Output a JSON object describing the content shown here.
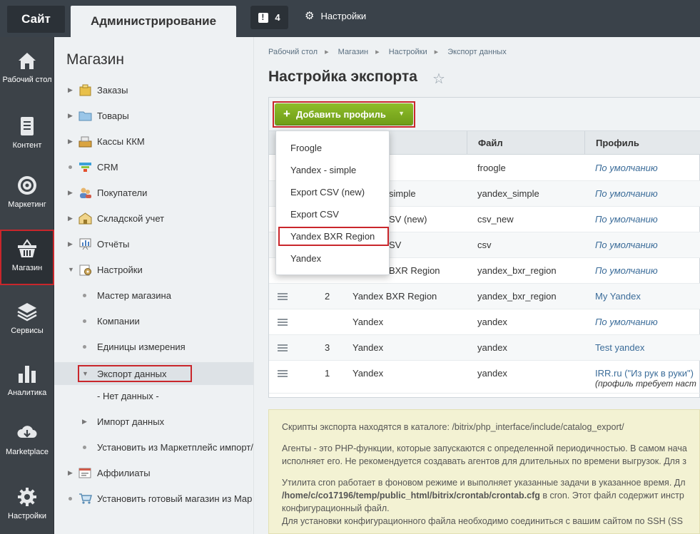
{
  "top": {
    "site_tab": "Сайт",
    "admin_tab": "Администрирование",
    "notif_count": "4",
    "settings": "Настройки"
  },
  "iconbar": [
    {
      "label": "Рабочий стол",
      "icon": "home-icon"
    },
    {
      "label": "Контент",
      "icon": "document-icon"
    },
    {
      "label": "Маркетинг",
      "icon": "target-icon"
    },
    {
      "label": "Магазин",
      "icon": "basket-icon"
    },
    {
      "label": "Сервисы",
      "icon": "layers-icon"
    },
    {
      "label": "Аналитика",
      "icon": "bar-chart-icon"
    },
    {
      "label": "Marketplace",
      "icon": "cloud-download-icon"
    },
    {
      "label": "Настройки",
      "icon": "gear-icon"
    }
  ],
  "menu": {
    "title": "Магазин",
    "items": [
      {
        "label": "Заказы"
      },
      {
        "label": "Товары"
      },
      {
        "label": "Кассы ККМ"
      },
      {
        "label": "CRM"
      },
      {
        "label": "Покупатели"
      },
      {
        "label": "Складской учет"
      },
      {
        "label": "Отчёты"
      },
      {
        "label": "Настройки"
      },
      {
        "label": "Мастер магазина"
      },
      {
        "label": "Компании"
      },
      {
        "label": "Единицы измерения"
      },
      {
        "label": "Экспорт данных"
      },
      {
        "label": "- Нет данных -"
      },
      {
        "label": "Импорт данных"
      },
      {
        "label": "Установить из Маркетплейс импорт/"
      },
      {
        "label": "Аффилиаты"
      },
      {
        "label": "Установить готовый магазин из Мар"
      }
    ]
  },
  "breadcrumbs": [
    "Рабочий стол",
    "Магазин",
    "Настройки",
    "Экспорт данных"
  ],
  "page_title": "Настройка экспорта",
  "toolbar": {
    "add_profile": "Добавить профиль"
  },
  "table": {
    "headers": [
      "ме",
      "Файл",
      "Профиль"
    ],
    "rows": [
      {
        "id": "",
        "name": "",
        "file": "froogle",
        "profile": "По умолчанию"
      },
      {
        "id": "",
        "name": "simple",
        "file": "yandex_simple",
        "profile": "По умолчанию"
      },
      {
        "id": "",
        "name": "SV (new)",
        "file": "csv_new",
        "profile": "По умолчанию"
      },
      {
        "id": "",
        "name": "SV",
        "file": "csv",
        "profile": "По умолчанию"
      },
      {
        "id": "",
        "name": "BXR Region",
        "file": "yandex_bxr_region",
        "profile": "По умолчанию"
      },
      {
        "id": "2",
        "name": "Yandex BXR Region",
        "file": "yandex_bxr_region",
        "profile": "My Yandex"
      },
      {
        "id": "",
        "name": "Yandex",
        "file": "yandex",
        "profile": "По умолчанию"
      },
      {
        "id": "3",
        "name": "Yandex",
        "file": "yandex",
        "profile": "Test yandex"
      },
      {
        "id": "1",
        "name": "Yandex",
        "file": "yandex",
        "profile": "IRR.ru (\"Из рук в руки\")",
        "profile_note": "(профиль требует наст"
      }
    ]
  },
  "dropdown": [
    "Froogle",
    "Yandex - simple",
    "Export CSV (new)",
    "Export CSV",
    "Yandex BXR Region",
    "Yandex"
  ],
  "note": {
    "line1": "Скрипты экспорта находятся в каталоге: /bitrix/php_interface/include/catalog_export/",
    "line2a": "Агенты - это PHP-функции, которые запускаются с определенной периодичностью. В самом нача",
    "line2b": "исполняет его. Не рекомендуется создавать агентов для длительных по времени выгрузок. Для з",
    "line3a": "Утилита cron работает в фоновом режиме и выполняет указанные задачи в указанное время. Дл",
    "line3b_bold": "/home/c/co17196/temp/public_html/bitrix/crontab/crontab.cfg",
    "line3b_rest": " в cron. Этот файл содержит инстр",
    "line3c": "конфигурационный файл.",
    "line3d": "Для установки конфигурационного файла необходимо соединиться с вашим сайтом по SSH (SS"
  }
}
